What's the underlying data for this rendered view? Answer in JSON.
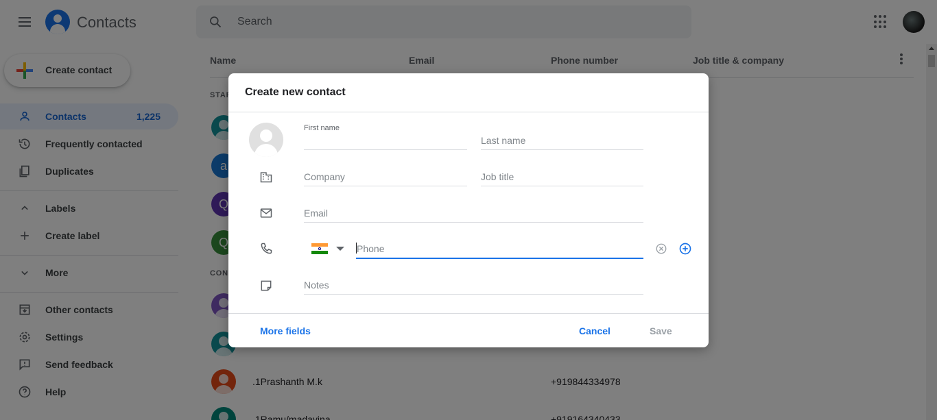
{
  "app": {
    "title": "Contacts"
  },
  "search": {
    "placeholder": "Search"
  },
  "sidebar": {
    "create_label": "Create contact",
    "items": [
      {
        "label": "Contacts",
        "count": "1,225",
        "icon": "person-icon"
      },
      {
        "label": "Frequently contacted",
        "icon": "history-icon"
      },
      {
        "label": "Duplicates",
        "icon": "copy-icon"
      },
      {
        "label": "Labels",
        "icon": "chevron-up-icon"
      },
      {
        "label": "Create label",
        "icon": "plus-icon"
      },
      {
        "label": "More",
        "icon": "chevron-down-icon"
      },
      {
        "label": "Other contacts",
        "icon": "archive-icon"
      },
      {
        "label": "Settings",
        "icon": "gear-icon"
      },
      {
        "label": "Send feedback",
        "icon": "feedback-icon"
      },
      {
        "label": "Help",
        "icon": "help-icon"
      }
    ]
  },
  "list": {
    "columns": [
      "Name",
      "Email",
      "Phone number",
      "Job title & company"
    ],
    "sections": [
      "STAR",
      "CONT"
    ],
    "rows": [
      {
        "initial": "",
        "name": "",
        "phone": "",
        "color": "#12939a"
      },
      {
        "initial": "a",
        "name": "",
        "phone": "",
        "color": "#1976d2"
      },
      {
        "initial": "Q",
        "name": "",
        "phone": "",
        "color": "#5e35b1"
      },
      {
        "initial": "Q",
        "name": "",
        "phone": "",
        "color": "#388e3c"
      },
      {
        "initial": "",
        "name": "",
        "phone": "",
        "color": "#7e57c2"
      },
      {
        "initial": "",
        "name": "",
        "phone": "",
        "color": "#12939a"
      },
      {
        "initial": "",
        "name": ".1Prashanth M.k",
        "phone": "+919844334978",
        "color": "#e64a19"
      },
      {
        "initial": "",
        "name": ".1Ramu/madavina",
        "phone": "+919164340433",
        "color": "#00897b"
      }
    ]
  },
  "dialog": {
    "title": "Create new contact",
    "first_name_label": "First name",
    "last_name_placeholder": "Last name",
    "company_placeholder": "Company",
    "job_title_placeholder": "Job title",
    "email_placeholder": "Email",
    "phone_placeholder": "Phone",
    "notes_placeholder": "Notes",
    "more_fields": "More fields",
    "cancel": "Cancel",
    "save": "Save",
    "country_flag": "india-flag-icon"
  },
  "colors": {
    "accent": "#1a73e8",
    "active_bg": "#e8f0fe"
  }
}
